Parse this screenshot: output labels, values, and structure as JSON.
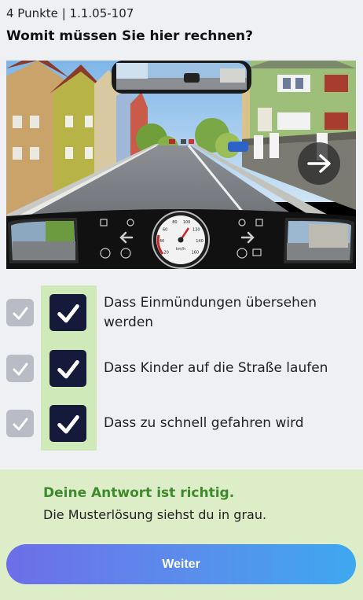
{
  "header": {
    "points": "4 Punkte",
    "separator": "|",
    "code": "1.1.05-107"
  },
  "question": "Womit müssen Sie hier rechnen?",
  "scene": {
    "icons": [
      "rearview-mirror",
      "side-mirror-left",
      "side-mirror-right",
      "speedometer",
      "next-arrow-icon",
      "turn-signal-left-icon",
      "turn-signal-right-icon",
      "headlight-icon",
      "abs-icon",
      "steering-icon"
    ],
    "speedometer": {
      "unit": "km/h",
      "ticks": [
        "20",
        "40",
        "60",
        "80",
        "100",
        "120",
        "140",
        "160"
      ]
    }
  },
  "answers": [
    {
      "text": "Dass Einmündungen übersehen werden",
      "user_checked": true,
      "solution_checked": true
    },
    {
      "text": "Dass Kinder auf die Straße laufen",
      "user_checked": true,
      "solution_checked": true
    },
    {
      "text": "Dass zu schnell gefahren wird",
      "user_checked": true,
      "solution_checked": true
    }
  ],
  "result": {
    "title": "Deine Antwort ist richtig.",
    "subtitle": "Die Musterlösung siehst du in grau."
  },
  "next_button": "Weiter",
  "colors": {
    "background": "#eff0f4",
    "result_bg": "#dcedc8",
    "result_title": "#3f8a2d",
    "answers_band": "#cfe9b8",
    "user_check_bg": "#151a3b",
    "solution_check_bg": "#b9bcc4",
    "button_gradient_start": "#6d6ee8",
    "button_gradient_end": "#3ea8f0"
  }
}
